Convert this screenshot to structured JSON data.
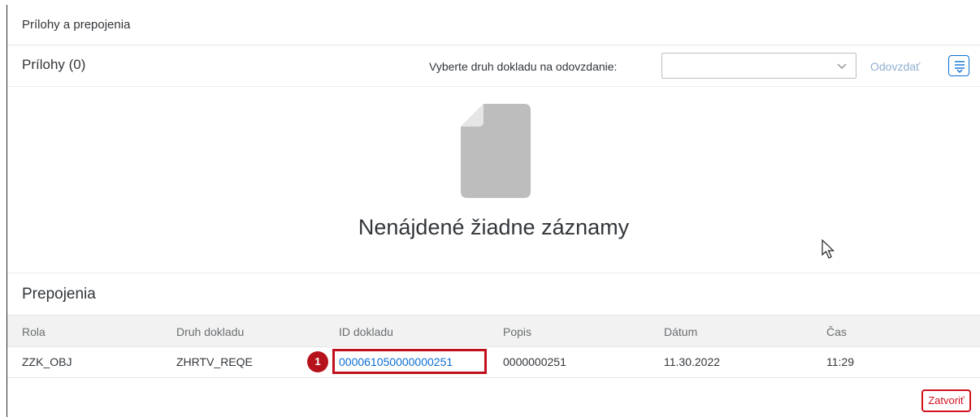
{
  "dialog": {
    "title": "Prílohy a prepojenia",
    "close_label": "Zatvoriť"
  },
  "attachments": {
    "title": "Prílohy (0)",
    "doc_type_label": "Vyberte druh dokladu na odovzdanie:",
    "doc_type_value": "",
    "upload_label": "Odovzdať",
    "empty_text": "Nenájdené žiadne záznamy"
  },
  "links": {
    "title": "Prepojenia",
    "columns": [
      "Rola",
      "Druh dokladu",
      "ID dokladu",
      "Popis",
      "Dátum",
      "Čas"
    ],
    "rows": [
      [
        "ZZK_OBJ",
        "ZHRTV_REQE",
        "000061050000000251",
        "0000000251",
        "11.30.2022",
        "11:29"
      ]
    ],
    "marker": "1"
  },
  "colors": {
    "link": "#0a6ed1",
    "highlight": "#c0101c",
    "accent": "#0a6ed1"
  },
  "icons": {
    "settings": "settings-icon",
    "dropdown": "chevron-down-icon",
    "empty": "document-icon",
    "cursor": "mouse-cursor-icon"
  }
}
